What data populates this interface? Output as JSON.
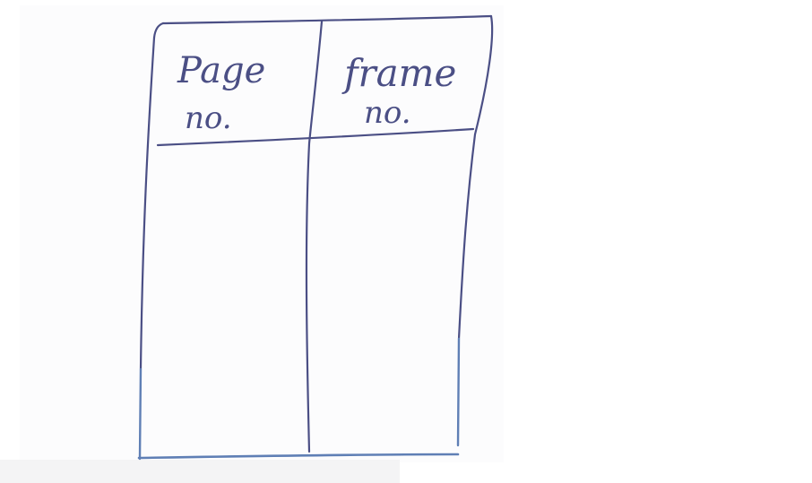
{
  "table": {
    "headers": [
      {
        "line1": "Page",
        "line2": "no."
      },
      {
        "line1": "frame",
        "line2": "no."
      }
    ],
    "rows": []
  },
  "colors": {
    "ink": "#4b4f85",
    "ink_light": "#5f7fb5",
    "paper": "#fcfcfd"
  }
}
